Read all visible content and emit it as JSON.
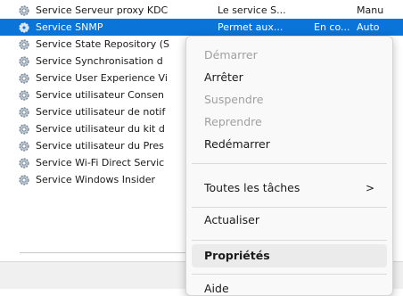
{
  "services": [
    {
      "name": "Service Serveur proxy KDC",
      "description": "Le service S...",
      "startup": "Manu"
    },
    {
      "name": "Service SNMP",
      "description": "Permet aux...",
      "startup": "Auto",
      "status": "En co..."
    },
    {
      "name": "Service State Repository (S",
      "description": "",
      "startup": ""
    },
    {
      "name": "Service Synchronisation d",
      "description": "",
      "startup": ""
    },
    {
      "name": "Service User Experience Vi",
      "description": "",
      "startup": ""
    },
    {
      "name": "Service utilisateur Consen",
      "description": "",
      "startup": ""
    },
    {
      "name": "Service utilisateur de notif",
      "description": "",
      "startup": ""
    },
    {
      "name": "Service utilisateur du kit d",
      "description": "",
      "startup": ""
    },
    {
      "name": "Service utilisateur du Pres",
      "description": "",
      "startup": ""
    },
    {
      "name": "Service Wi-Fi Direct Servic",
      "description": "",
      "startup": ""
    },
    {
      "name": "Service Windows Insider",
      "description": "",
      "startup": ""
    }
  ],
  "context_menu": {
    "items": [
      {
        "label": "Démarrer",
        "disabled": true
      },
      {
        "label": "Arrêter",
        "disabled": false
      },
      {
        "label": "Suspendre",
        "disabled": true
      },
      {
        "label": "Reprendre",
        "disabled": true
      },
      {
        "label": "Redémarrer",
        "disabled": false
      },
      {
        "label": "Toutes les tâches",
        "disabled": false,
        "submenu_arrow": ">"
      },
      {
        "label": "Actualiser",
        "disabled": false
      },
      {
        "label": "Propriétés",
        "disabled": false,
        "bold": true
      },
      {
        "label": "Aide",
        "disabled": false
      }
    ]
  },
  "colors": {
    "selection": "#0a74d8",
    "menu_background": "#f9f9f9"
  },
  "icons": {
    "service_row": "gear-icon",
    "submenu": "chevron-right-icon"
  }
}
